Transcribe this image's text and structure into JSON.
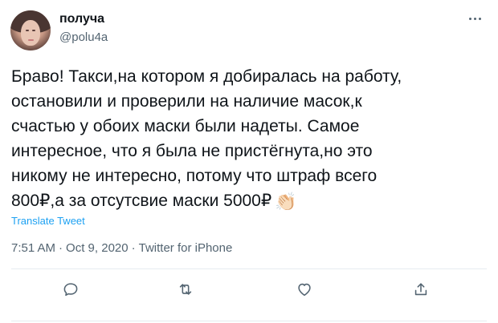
{
  "user": {
    "display_name": "получа",
    "handle": "@polu4a",
    "avatar_icon": "avatar-photo"
  },
  "tweet": {
    "text": "Браво! Такси,на котором я добиралась на работу,\nостановили и проверили на наличие масок,к\nсчастью у обоих маски были надеты. Самое\nинтересное, что я была не пристёгнута,но это\nникому не интересно, потому что штраф всего\n800₽,а за отсутсвие маски 5000₽",
    "emoji": "👏🏻",
    "translate_label": "Translate Tweet",
    "time": "7:51 AM",
    "date": "Oct 9, 2020",
    "separator": "·",
    "source": "Twitter for iPhone"
  },
  "actions": {
    "icons": [
      "reply-icon",
      "retweet-icon",
      "like-icon",
      "share-icon"
    ]
  },
  "colors": {
    "text": "#0f1419",
    "secondary": "#536471",
    "link": "#1da1f2",
    "divider": "#e6ecf0"
  }
}
